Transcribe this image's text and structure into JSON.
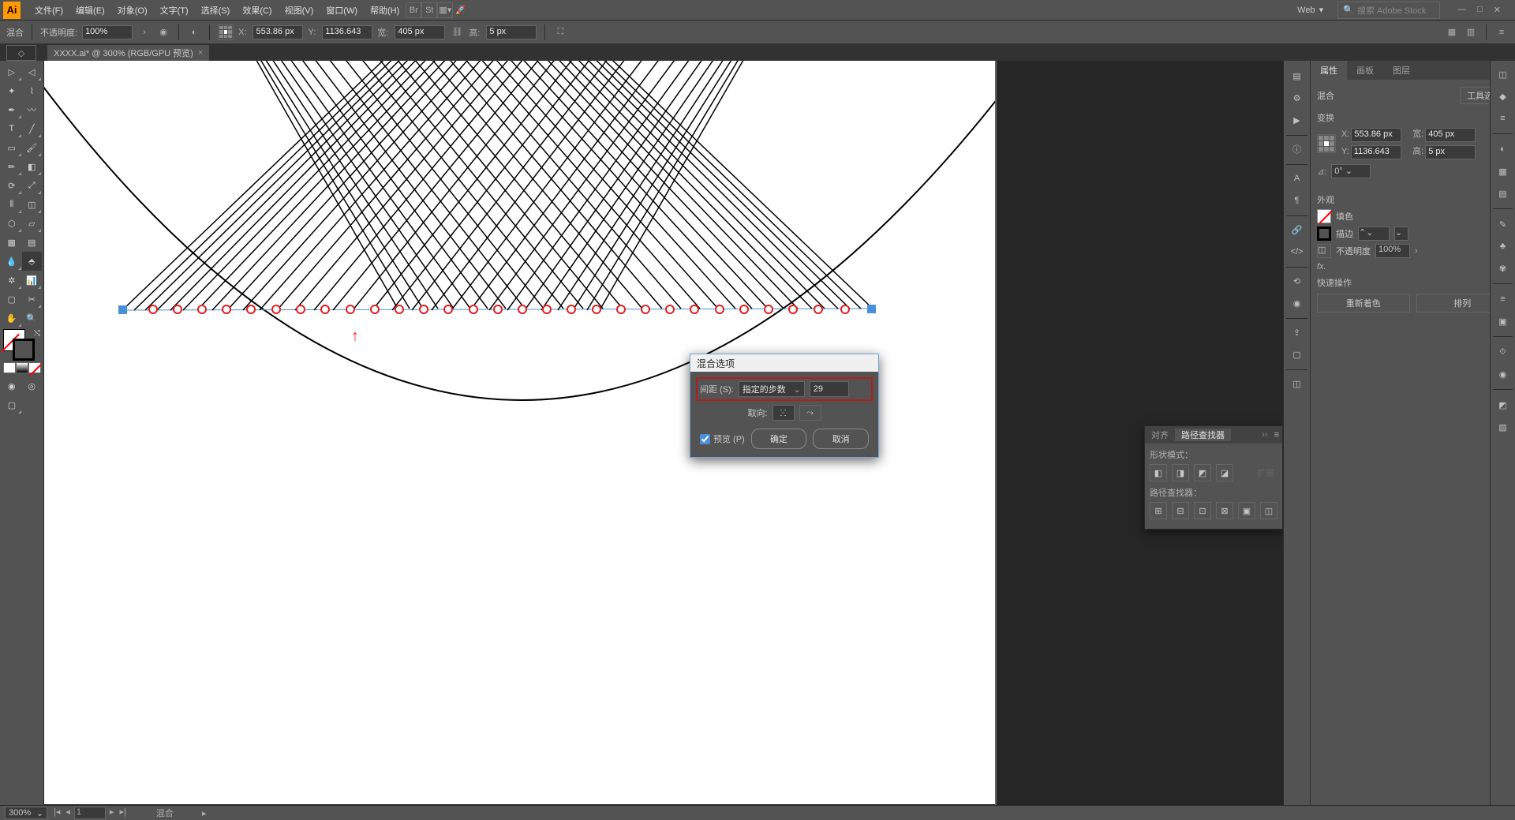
{
  "app_logo": "Ai",
  "menus": {
    "file": "文件(F)",
    "edit": "编辑(E)",
    "object": "对象(O)",
    "type": "文字(T)",
    "select": "选择(S)",
    "effect": "效果(C)",
    "view": "视图(V)",
    "window": "窗口(W)",
    "help": "帮助(H)"
  },
  "menubar_right": {
    "web_label": "Web",
    "search_placeholder": "搜索 Adobe Stock",
    "br": "Br",
    "st": "St"
  },
  "controlbar": {
    "blend_label": "混合",
    "opacity_label": "不透明度:",
    "opacity_value": "100%",
    "x_label": "X:",
    "x_value": "553.86 px",
    "y_label": "Y:",
    "y_value": "1136.643",
    "w_label": "宽:",
    "w_value": "405 px",
    "h_label": "高:",
    "h_value": "5 px"
  },
  "document_tab": "XXXX.ai* @ 300% (RGB/GPU 预览)",
  "start_tab": "◇",
  "dialog": {
    "title": "混合选项",
    "spacing_label": "间距 (S):",
    "spacing_mode": "指定的步数",
    "spacing_value": "29",
    "orientation_label": "取向:",
    "preview_label": "预览 (P)",
    "ok": "确定",
    "cancel": "取消"
  },
  "properties_panel": {
    "tab_props": "属性",
    "tab_artboards": "画板",
    "tab_layers": "图层",
    "blend_header": "混合",
    "tool_options": "工具选项",
    "transform_title": "变换",
    "x_label": "X:",
    "x_val": "553.86 px",
    "y_label": "Y:",
    "y_val": "1136.643",
    "w_label": "宽:",
    "w_val": "405 px",
    "h_label": "高:",
    "h_val": "5 px",
    "angle_label": "⊿:",
    "angle_val": "0°",
    "appearance_title": "外观",
    "fill_label": "填色",
    "stroke_label": "描边",
    "opacity_label": "不透明度",
    "opacity_val": "100%",
    "fx_label": "fx.",
    "quick_title": "快速操作",
    "recolor": "重新着色",
    "arrange": "排列"
  },
  "align_panel": {
    "tab_align": "对齐",
    "tab_pathfinder": "路径查找器",
    "shape_modes": "形状模式：",
    "expand": "扩展",
    "pathfinders": "路径查找器："
  },
  "statusbar": {
    "zoom": "300%",
    "page": "1",
    "tool": "混合"
  }
}
